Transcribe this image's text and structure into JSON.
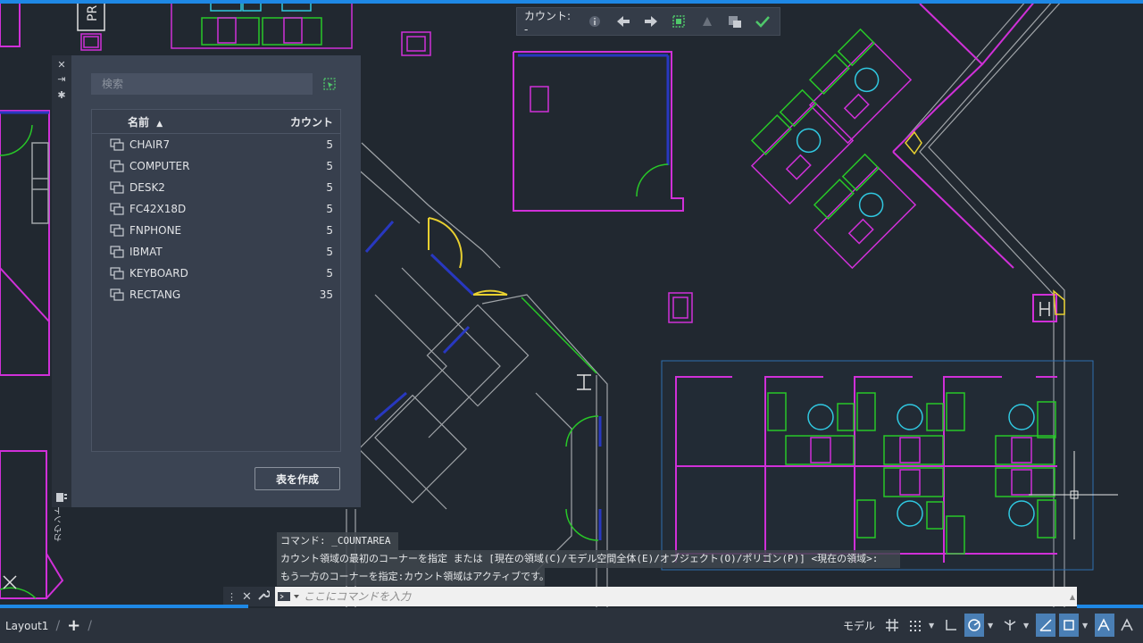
{
  "toolbar": {
    "label": "カウント:",
    "value": "-"
  },
  "palette": {
    "title": "カウント",
    "search_placeholder": "検索",
    "columns": {
      "name": "名前",
      "count": "カウント"
    },
    "rows": [
      {
        "name": "CHAIR7",
        "count": "5"
      },
      {
        "name": "COMPUTER",
        "count": "5"
      },
      {
        "name": "DESK2",
        "count": "5"
      },
      {
        "name": "FC42X18D",
        "count": "5"
      },
      {
        "name": "FNPHONE",
        "count": "5"
      },
      {
        "name": "IBMAT",
        "count": "5"
      },
      {
        "name": "KEYBOARD",
        "count": "5"
      },
      {
        "name": "RECTANG",
        "count": "35"
      }
    ],
    "create_table_label": "表を作成"
  },
  "drawing": {
    "label_pr": "PR"
  },
  "command": {
    "history": [
      "コマンド: _COUNTAREA",
      "カウント領域の最初のコーナーを指定 または [現在の領域(C)/モデル空間全体(E)/オブジェクト(O)/ポリゴン(P)] <現在の領域>:",
      "もう一方のコーナーを指定:カウント領域はアクティブです。"
    ],
    "input_placeholder": "ここにコマンドを入力"
  },
  "status": {
    "layout_tab": "Layout1",
    "add_symbol": "+",
    "model_label": "モデル"
  },
  "colors": {
    "background": "#212830",
    "accent": "#1e88e5",
    "magenta": "#d030d8",
    "green": "#28c828",
    "cyan": "#30c8e0",
    "yellow": "#e8d030",
    "blue": "#2838c0",
    "gray": "#a0a4a8"
  }
}
